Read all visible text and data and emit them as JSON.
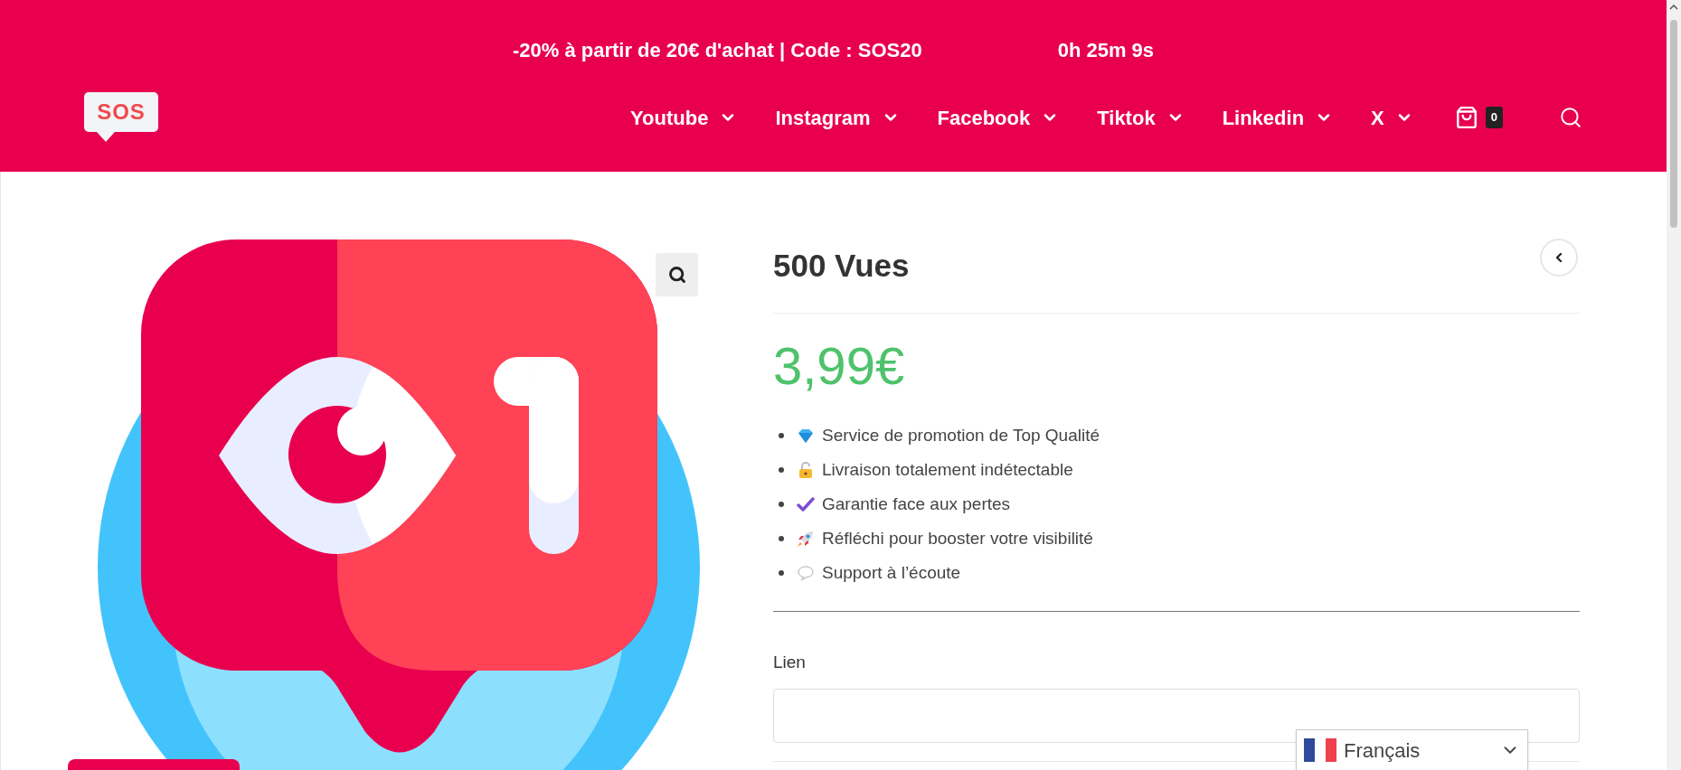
{
  "promo_bar": {
    "text": "-20% à partir de 20€ d'achat | Code : SOS20",
    "countdown": "0h 25m 9s"
  },
  "header": {
    "logo": "SOS",
    "nav": [
      {
        "label": "Youtube"
      },
      {
        "label": "Instagram"
      },
      {
        "label": "Facebook"
      },
      {
        "label": "Tiktok"
      },
      {
        "label": "Linkedin"
      },
      {
        "label": "X"
      }
    ],
    "cart_count": "0"
  },
  "product": {
    "title": "500 Vues",
    "price": "3,99€",
    "features": [
      {
        "kind": "diamond",
        "text": "Service de promotion de Top Qualité"
      },
      {
        "kind": "lock",
        "text": "Livraison totalement indétectable"
      },
      {
        "kind": "check",
        "text": "Garantie face aux pertes"
      },
      {
        "kind": "rocket",
        "text": "Réfléchi pour booster votre visibilité"
      },
      {
        "kind": "bubble",
        "text": "Support à l’écoute"
      }
    ],
    "field": {
      "label": "Lien"
    }
  },
  "language": {
    "label": "Français"
  }
}
